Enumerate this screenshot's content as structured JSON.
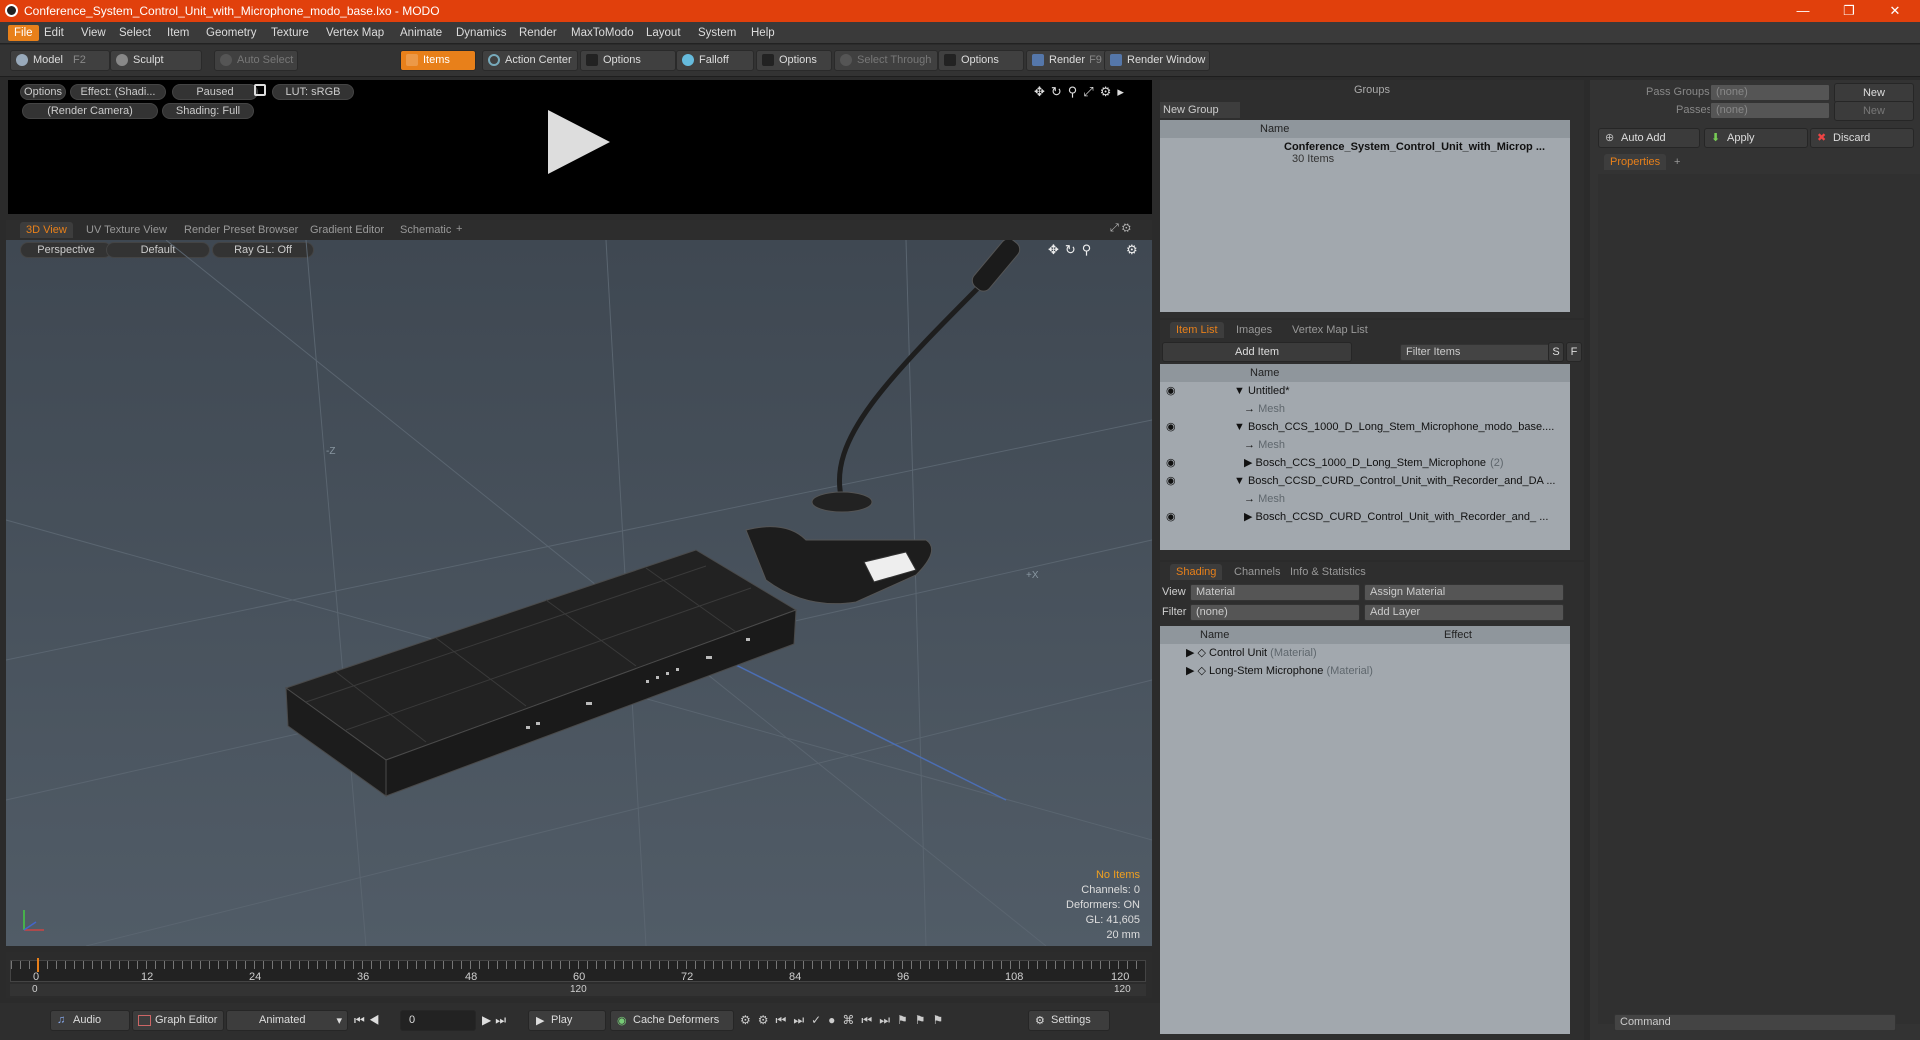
{
  "window": {
    "title": "Conference_System_Control_Unit_with_Microphone_modo_base.lxo - MODO",
    "min": "—",
    "max": "❐",
    "close": "✕"
  },
  "menu": [
    "File",
    "Edit",
    "View",
    "Select",
    "Item",
    "Geometry",
    "Texture",
    "Vertex Map",
    "Animate",
    "Dynamics",
    "Render",
    "MaxToModo",
    "Layout",
    "System",
    "Help"
  ],
  "toolbar": {
    "model": "Model",
    "model_key": "F2",
    "sculpt": "Sculpt",
    "auto_select": "Auto Select",
    "items": "Items",
    "action_center": "Action Center",
    "options1": "Options",
    "falloff": "Falloff",
    "options2": "Options",
    "select_through": "Select Through",
    "options3": "Options",
    "render": "Render",
    "render_key": "F9",
    "render_window": "Render Window"
  },
  "preview": {
    "options": "Options",
    "effect": "Effect: (Shadi...",
    "paused": "Paused",
    "lut": "LUT: sRGB",
    "camera": "(Render Camera)",
    "shading": "Shading: Full"
  },
  "viewport_tabs": [
    "3D View",
    "UV Texture View",
    "Render Preset Browser",
    "Gradient Editor",
    "Schematic"
  ],
  "viewport": {
    "perspective": "Perspective",
    "default": "Default",
    "raygl": "Ray GL: Off",
    "axis_neg_z": "-Z",
    "axis_pos_x": "+X",
    "info": {
      "no_items": "No Items",
      "channels": "Channels: 0",
      "deformers": "Deformers: ON",
      "gl": "GL: 41,605",
      "scale": "20 mm"
    }
  },
  "timeline": {
    "ticks": [
      "0",
      "12",
      "24",
      "36",
      "48",
      "60",
      "72",
      "84",
      "96",
      "108",
      "120"
    ],
    "sub_left": "0",
    "sub_mid": "120",
    "sub_right": "120"
  },
  "bottom": {
    "audio": "Audio",
    "graph_editor": "Graph Editor",
    "animated": "Animated",
    "frame": "0",
    "play": "Play",
    "cache_deformers": "Cache Deformers",
    "settings": "Settings"
  },
  "groups": {
    "title": "Groups",
    "new_group": "New Group",
    "col_name": "Name",
    "item_name": "Conference_System_Control_Unit_with_Microp ...",
    "item_count": "30 Items"
  },
  "itemlist": {
    "tabs": [
      "Item List",
      "Images",
      "Vertex Map List"
    ],
    "add_item": "Add Item",
    "filter": "Filter Items",
    "s": "S",
    "f": "F",
    "col_name": "Name",
    "rows": [
      {
        "label": "Untitled*",
        "ind": 0,
        "exp": "▼",
        "gray": false
      },
      {
        "label": "Mesh",
        "ind": 1,
        "exp": "",
        "gray": true
      },
      {
        "label": "Bosch_CCS_1000_D_Long_Stem_Microphone_modo_base....",
        "ind": 0,
        "exp": "▼",
        "gray": false
      },
      {
        "label": "Mesh",
        "ind": 1,
        "exp": "",
        "gray": true
      },
      {
        "label": "Bosch_CCS_1000_D_Long_Stem_Microphone",
        "ind": 1,
        "exp": "▶",
        "gray": false,
        "suffix": "(2)"
      },
      {
        "label": "Bosch_CCSD_CURD_Control_Unit_with_Recorder_and_DA ...",
        "ind": 0,
        "exp": "▼",
        "gray": false
      },
      {
        "label": "Mesh",
        "ind": 1,
        "exp": "",
        "gray": true
      },
      {
        "label": "Bosch_CCSD_CURD_Control_Unit_with_Recorder_and_ ...",
        "ind": 1,
        "exp": "▶",
        "gray": false
      }
    ]
  },
  "shading": {
    "tabs": [
      "Shading",
      "Channels",
      "Info & Statistics"
    ],
    "view_label": "View",
    "view_value": "Material",
    "assign_material": "Assign Material",
    "filter_label": "Filter",
    "filter_value": "(none)",
    "add_layer": "Add Layer",
    "col_name": "Name",
    "col_effect": "Effect",
    "rows": [
      {
        "label": "Control Unit",
        "type": "(Material)"
      },
      {
        "label": "Long-Stem Microphone",
        "type": "(Material)"
      }
    ]
  },
  "props": {
    "pass_groups": "Pass Groups",
    "passes": "Passes",
    "none": "(none)",
    "new": "New",
    "auto_add": "Auto Add",
    "apply": "Apply",
    "discard": "Discard",
    "tab": "Properties",
    "command": "Command"
  }
}
